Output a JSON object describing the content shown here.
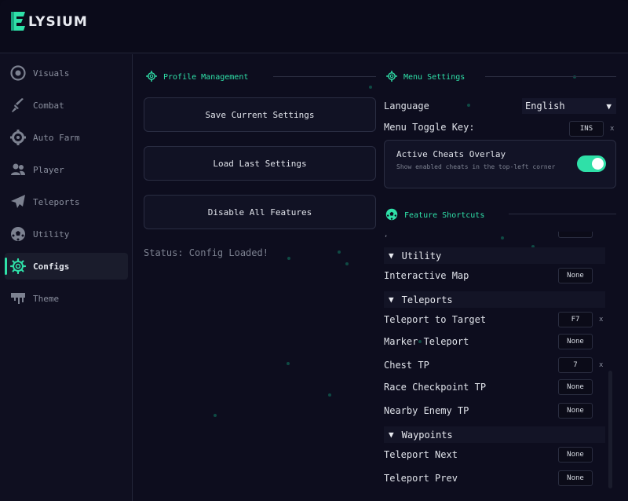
{
  "app": {
    "logo_text": "LYSIUM",
    "logo_letter": "E",
    "accent": "#2fe0a8"
  },
  "sidebar": {
    "items": [
      {
        "label": "Visuals",
        "icon": "eye-icon"
      },
      {
        "label": "Combat",
        "icon": "sword-icon"
      },
      {
        "label": "Auto Farm",
        "icon": "gear-icon"
      },
      {
        "label": "Player",
        "icon": "users-icon"
      },
      {
        "label": "Teleports",
        "icon": "paper-plane-icon"
      },
      {
        "label": "Utility",
        "icon": "soccer-ball-icon"
      },
      {
        "label": "Configs",
        "icon": "settings-icon",
        "active": true
      },
      {
        "label": "Theme",
        "icon": "paint-drip-icon"
      }
    ]
  },
  "profile": {
    "title": "Profile Management",
    "save_label": "Save Current Settings",
    "load_label": "Load Last Settings",
    "disable_label": "Disable All Features",
    "status_text": "Status: Config Loaded!"
  },
  "menu_settings": {
    "title": "Menu Settings",
    "language_label": "Language",
    "language_value": "English",
    "toggle_key_label": "Menu Toggle Key:",
    "toggle_key_value": "INS",
    "clear_label": "x",
    "overlay_title": "Active Cheats Overlay",
    "overlay_desc": "Show enabled cheats in the top-left corner",
    "overlay_enabled": true
  },
  "shortcuts": {
    "title": "Feature Shortcuts",
    "groups": [
      {
        "name": "Utility",
        "items": [
          {
            "label": "Interactive Map",
            "key": "None"
          }
        ]
      },
      {
        "name": "Teleports",
        "items": [
          {
            "label": "Teleport to Target",
            "key": "F7",
            "clear": "x"
          },
          {
            "label": "Marker Teleport",
            "key": "None"
          },
          {
            "label": "Chest TP",
            "key": "7",
            "clear": "x"
          },
          {
            "label": "Race Checkpoint TP",
            "key": "None"
          },
          {
            "label": "Nearby Enemy TP",
            "key": "None"
          }
        ]
      },
      {
        "name": "Waypoints",
        "items": [
          {
            "label": "Teleport Next",
            "key": "None"
          },
          {
            "label": "Teleport Prev",
            "key": "None"
          }
        ]
      }
    ]
  }
}
